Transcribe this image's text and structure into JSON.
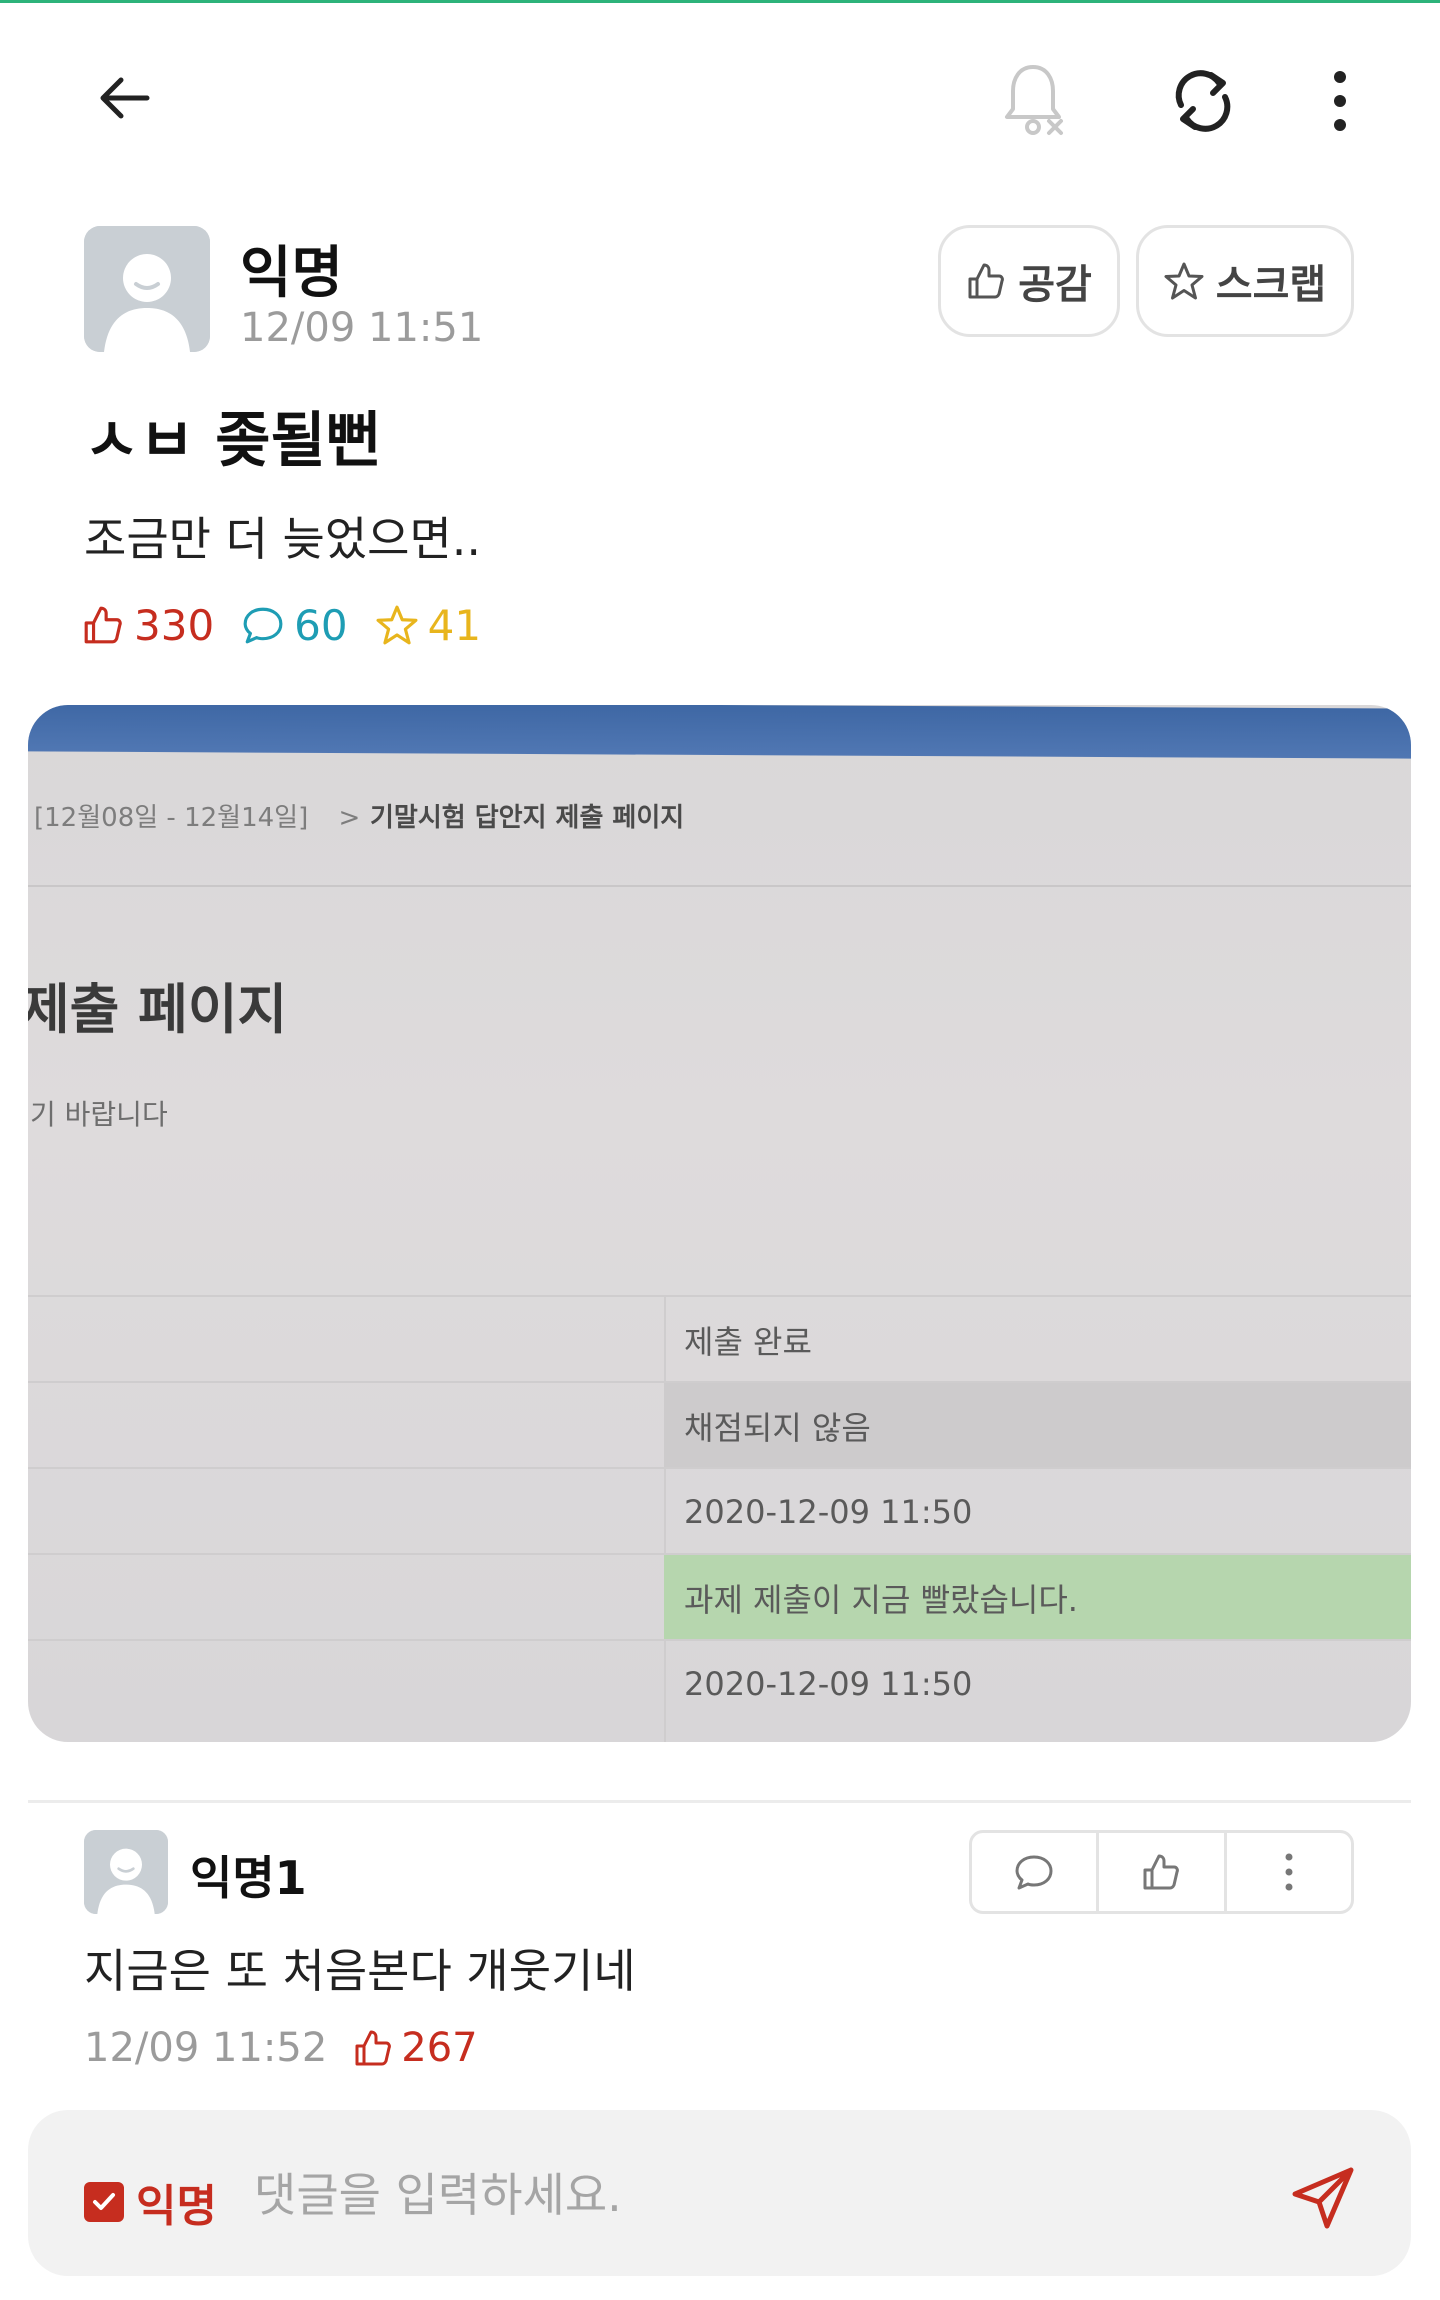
{
  "colors": {
    "accent_green": "#2db37a",
    "like_red": "#c62d1f",
    "comment_teal": "#1e9db4",
    "scrap_yellow": "#e8b51d"
  },
  "header": {
    "icons": [
      "back-arrow-icon",
      "bell-off-icon",
      "refresh-icon",
      "more-vertical-icon"
    ]
  },
  "post": {
    "author": "익명",
    "time": "12/09 11:51",
    "like_button_label": "공감",
    "scrap_button_label": "스크랩",
    "title": "ㅅㅂ 좆될뻔",
    "body": "조금만 더 늦었으면..",
    "stats": {
      "likes": "330",
      "comments": "60",
      "scraps": "41"
    }
  },
  "photo": {
    "breadcrumb_range": "[12월08일 - 12월14일]",
    "breadcrumb_sep": ">",
    "breadcrumb_current": "기말시험 답안지 제출 페이지",
    "heading": "제출 페이지",
    "subtext": "기 바랍니다",
    "rows": [
      "제출 완료",
      "채점되지 않음",
      "2020-12-09 11:50",
      "과제 제출이 지금 빨랐습니다.",
      "2020-12-09 11:50"
    ]
  },
  "comment": {
    "author": "익명1",
    "text": "지금은 또 처음본다 개웃기네",
    "time": "12/09 11:52",
    "likes": "267"
  },
  "input": {
    "anon_label": "익명",
    "anon_checked": true,
    "placeholder": "댓글을 입력하세요."
  }
}
